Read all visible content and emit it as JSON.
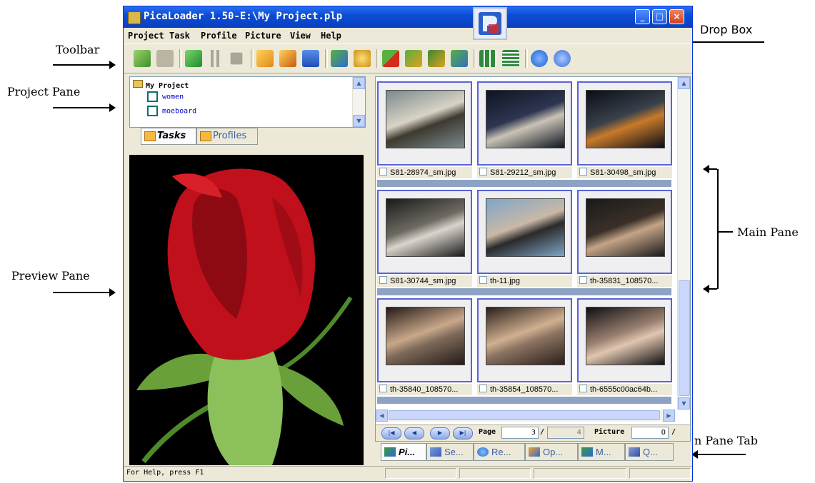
{
  "annotations": {
    "toolbar": "Toolbar",
    "project_pane": "Project Pane",
    "preview_pane": "Preview Pane",
    "drop_box": "Drop Box",
    "main_pane": "Main Pane",
    "main_pane_tab": "n Pane  Tab"
  },
  "window": {
    "title": "PicaLoader 1.50-E:\\My Project.plp",
    "minimize_glyph": "_",
    "maximize_glyph": "□",
    "close_glyph": "×"
  },
  "menu": [
    "Project",
    "Task",
    "Profile",
    "Picture",
    "View",
    "Help"
  ],
  "toolbar_icons": [
    "add-icon",
    "open-folder-icon",
    "start-icon",
    "pause-icon",
    "stop-icon",
    "open-project-icon",
    "open-icon",
    "save-icon",
    "network-icon",
    "settings-icon",
    "delete-icon",
    "copy-icon",
    "users-icon",
    "export-icon",
    "thumbnail-view-icon",
    "list-view-icon",
    "info-icon",
    "help-icon"
  ],
  "project_tree": {
    "root": "My Project",
    "items": [
      "women",
      "moeboard"
    ]
  },
  "left_tabs": [
    "Tasks",
    "Profiles"
  ],
  "thumbnails": [
    {
      "name": "S81-28974_sm.jpg"
    },
    {
      "name": "S81-29212_sm.jpg"
    },
    {
      "name": "S81-30498_sm.jpg"
    },
    {
      "name": "S81-30744_sm.jpg"
    },
    {
      "name": "th-11.jpg"
    },
    {
      "name": "th-35831_108570..."
    },
    {
      "name": "th-35840_108570..."
    },
    {
      "name": "th-35854_108570..."
    },
    {
      "name": "th-6555c00ac64b..."
    }
  ],
  "navigation": {
    "page_label": "Page",
    "page_value": "3",
    "page_total": "4",
    "picture_label": "Picture",
    "picture_value": "0"
  },
  "bottom_tabs": [
    "Pi...",
    "Se...",
    "Re...",
    "Op...",
    "M...",
    "Q..."
  ],
  "status": {
    "text": "For Help, press F1"
  }
}
